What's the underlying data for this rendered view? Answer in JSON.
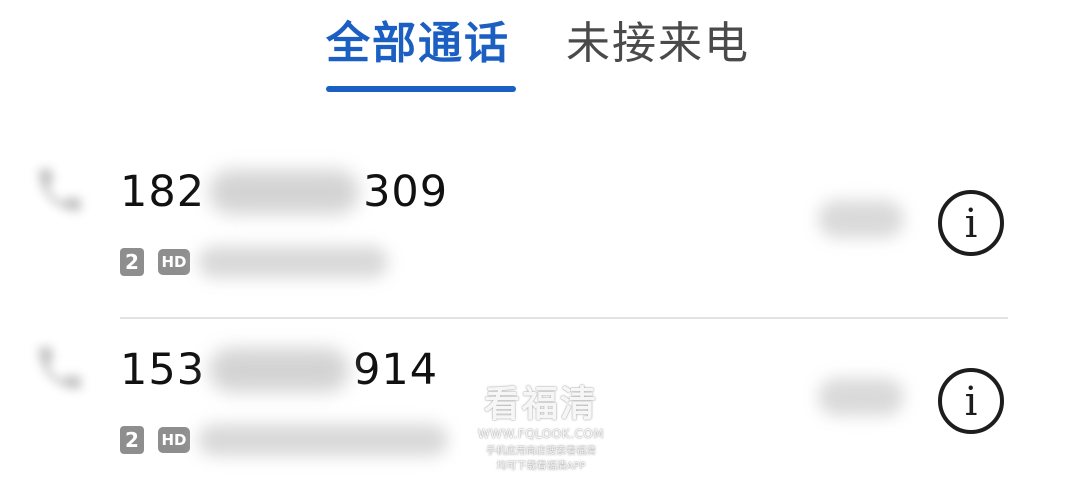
{
  "tabs": {
    "all_calls": "全部通话",
    "missed_calls": "未接来电",
    "active": "all_calls"
  },
  "calls": [
    {
      "number_prefix": "182",
      "number_suffix": "309",
      "sim": "2",
      "hd": "HD",
      "info_glyph": "i"
    },
    {
      "number_prefix": "153",
      "number_suffix": "914",
      "sim": "2",
      "hd": "HD",
      "info_glyph": "i"
    }
  ],
  "watermark": {
    "title": "看福清",
    "url": "WWW.FQLOOK.COM",
    "line1": "手机应用商店搜索看福清",
    "line2": "均可下载看福清APP"
  },
  "colors": {
    "accent": "#1b5fc2",
    "text": "#111111",
    "secondary": "#4a4a4a",
    "badge": "#8e8e8e",
    "divider": "#e2e2e2"
  },
  "icons": {
    "phone": "phone-icon",
    "info": "info-icon"
  }
}
